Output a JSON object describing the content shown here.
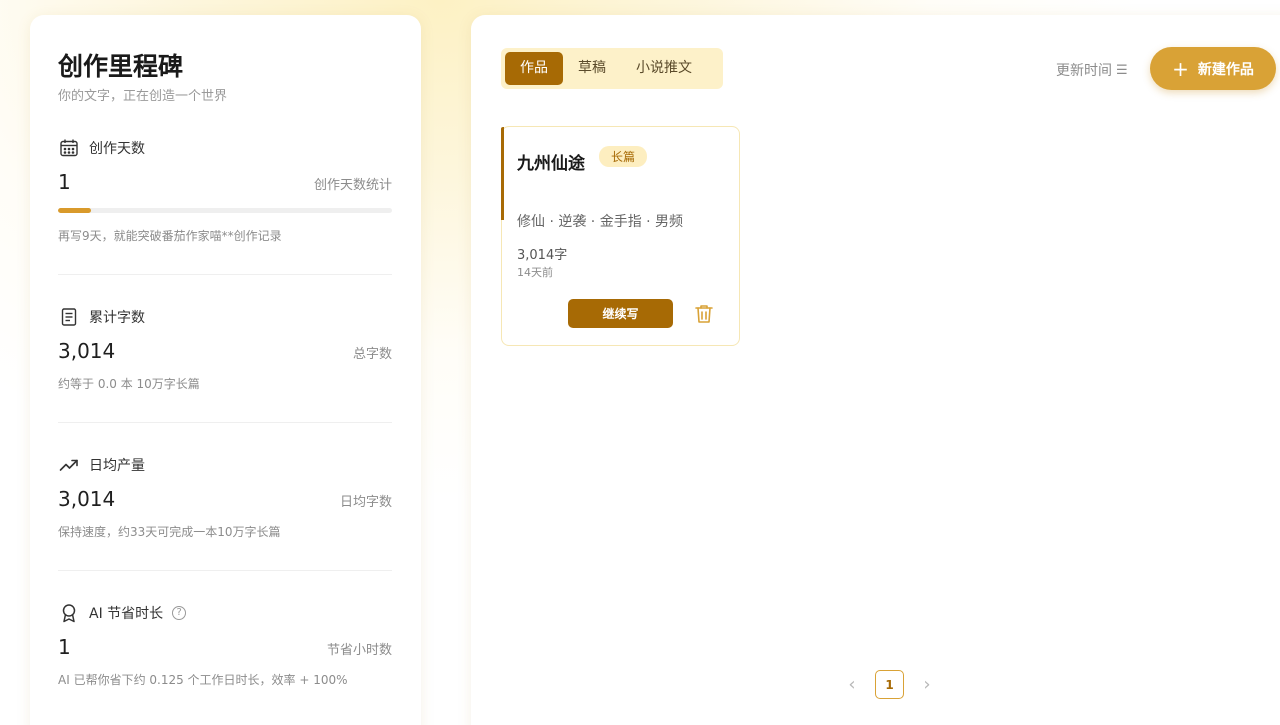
{
  "stats": {
    "title": "创作里程碑",
    "subtitle": "你的文字，正在创造一个世界",
    "days": {
      "label": "创作天数",
      "value": "1",
      "caption": "创作天数统计",
      "progress_percent": 10,
      "note": "再写9天，就能突破番茄作家喵**创作记录",
      "icon": "calendar-icon"
    },
    "words": {
      "label": "累计字数",
      "value": "3,014",
      "caption": "总字数",
      "note": "约等于 0.0 本 10万字长篇",
      "icon": "document-icon"
    },
    "daily": {
      "label": "日均产量",
      "value": "3,014",
      "caption": "日均字数",
      "note": "保持速度，约33天可完成一本10万字长篇",
      "icon": "trend-up-icon"
    },
    "ai": {
      "label": "AI 节省时长",
      "value": "1",
      "caption": "节省小时数",
      "note": "AI 已帮你省下约 0.125 个工作日时长，效率 + 100%",
      "icon": "award-icon",
      "help_icon": "help-circle-icon"
    }
  },
  "works": {
    "tabs": [
      {
        "label": "作品",
        "active": true
      },
      {
        "label": "草稿",
        "active": false
      },
      {
        "label": "小说推文",
        "active": false
      }
    ],
    "sort_label": "更新时间",
    "sort_icon": "sort-icon",
    "new_button_label": "新建作品",
    "cards": [
      {
        "title": "九州仙途",
        "badge": "长篇",
        "tags": "修仙 · 逆袭 · 金手指 · 男频",
        "words": "3,014字",
        "updated": "14天前",
        "continue_label": "继续写",
        "delete_icon": "trash-icon"
      }
    ],
    "pagination": {
      "current": "1"
    }
  },
  "colors": {
    "accent_dark": "#a76a05",
    "accent": "#d9a236",
    "accent_light": "#fdf1c9"
  }
}
